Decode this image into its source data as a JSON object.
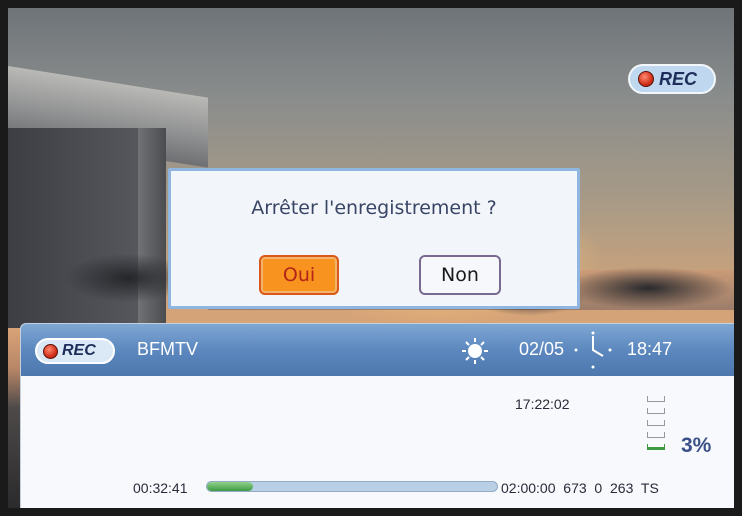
{
  "recording_badge": {
    "label": "REC"
  },
  "dialog": {
    "question": "Arrêter l'enregistrement ?",
    "yes_label": "Oui",
    "no_label": "Non"
  },
  "infobar": {
    "badge_label": "REC",
    "channel": "BFMTV",
    "weather_icon": "sun-icon",
    "date": "02/05",
    "clock_icon": "clock-icon",
    "time": "18:47",
    "recording_time": "17:22:02",
    "disk_usage_percent": "3%",
    "elapsed": "00:32:41",
    "progress_fraction": 0.16,
    "total_duration": "02:00:00",
    "code_a": "673",
    "code_b": "0",
    "code_c": "263",
    "code_d": "TS"
  },
  "colors": {
    "accent_orange": "#f7931e",
    "header_blue": "#5c88bf",
    "rec_red": "#d2301a"
  }
}
